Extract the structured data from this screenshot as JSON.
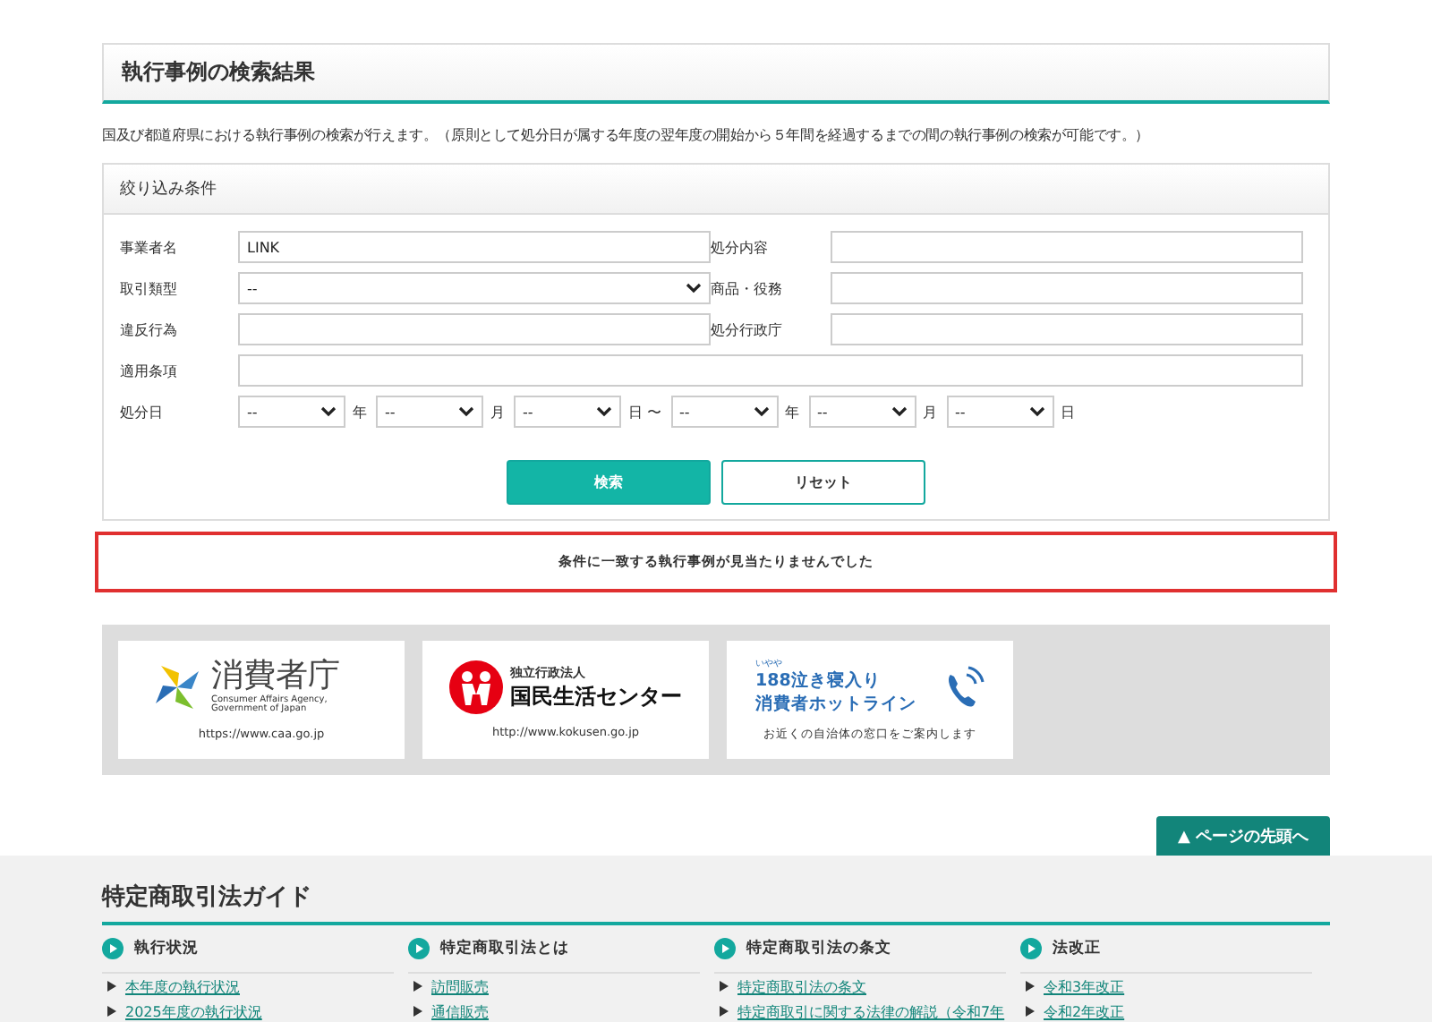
{
  "section_title": "執行事例の検索結果",
  "description": "国及び都道府県における執行事例の検索が行えます。（原則として処分日が属する年度の翌年度の開始から５年間を経過するまでの間の執行事例の検索が可能です。）",
  "filter": {
    "title": "絞り込み条件",
    "fields": [
      {
        "kind": "text",
        "label": "事業者名",
        "value": "LINK"
      },
      {
        "kind": "text",
        "label": "処分内容"
      },
      {
        "kind": "select",
        "label": "取引類型",
        "value": "--"
      },
      {
        "kind": "text",
        "label": "商品・役務"
      },
      {
        "kind": "text",
        "label": "違反行為"
      },
      {
        "kind": "text",
        "label": "処分行政庁"
      },
      {
        "kind": "wide_text",
        "label": "適用条項"
      }
    ],
    "date": {
      "label": "処分日",
      "parts": [
        {
          "value": "--",
          "unit": "年"
        },
        {
          "value": "--",
          "unit": "月"
        },
        {
          "value": "--",
          "unit": "日 〜"
        },
        {
          "value": "--",
          "unit": "年"
        },
        {
          "value": "--",
          "unit": "月"
        },
        {
          "value": "--",
          "unit": "日"
        }
      ]
    },
    "buttons": [
      {
        "label": "検索",
        "kind": "primary"
      },
      {
        "label": "リセット",
        "kind": "secondary"
      }
    ]
  },
  "result_message": "条件に一致する執行事例が見当たりませんでした",
  "banners": [
    {
      "kind": "caa",
      "title": "消費者庁",
      "subtitle": "Consumer Affairs Agency, Government of Japan",
      "caption": "https://www.caa.go.jp"
    },
    {
      "kind": "kokusen",
      "small": "独立行政法人",
      "title": "国民生活センター",
      "caption": "http://www.kokusen.go.jp"
    },
    {
      "kind": "hotline",
      "small": "いやや",
      "title": "188泣き寝入り",
      "title2": "消費者ホットライン",
      "caption": "お近くの自治体の窓口をご案内します"
    }
  ],
  "page_top": {
    "icon": "▲",
    "label": "ページの先頭へ"
  },
  "guide": {
    "title": "特定商取引法ガイド",
    "columns": [
      {
        "heading": "執行状況",
        "links": [
          "本年度の執行状況",
          "2025年度の執行状況"
        ]
      },
      {
        "heading": "特定商取引法とは",
        "links": [
          "訪問販売",
          "通信販売"
        ]
      },
      {
        "heading": "特定商取引法の条文",
        "links": [
          "特定商取引法の条文",
          "特定商取引に関する法律の解説（令和7年"
        ]
      },
      {
        "heading": "法改正",
        "links": [
          "令和3年改正",
          "令和2年改正"
        ]
      }
    ]
  }
}
